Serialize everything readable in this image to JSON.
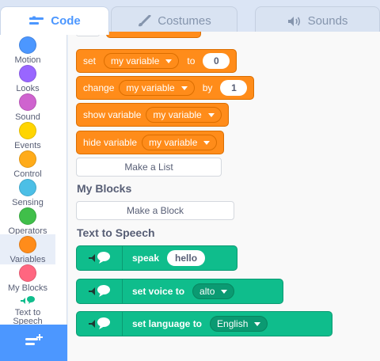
{
  "tabs": [
    {
      "label": "Code",
      "icon": "code-icon"
    },
    {
      "label": "Costumes",
      "icon": "brush-icon"
    },
    {
      "label": "Sounds",
      "icon": "speaker-icon"
    }
  ],
  "categories": [
    {
      "label": "Motion",
      "color": "#4c97ff"
    },
    {
      "label": "Looks",
      "color": "#9966ff"
    },
    {
      "label": "Sound",
      "color": "#cf63cf"
    },
    {
      "label": "Events",
      "color": "#ffd500"
    },
    {
      "label": "Control",
      "color": "#ffab19"
    },
    {
      "label": "Sensing",
      "color": "#4cbfe6"
    },
    {
      "label": "Operators",
      "color": "#40bf4a"
    },
    {
      "label": "Variables",
      "color": "#ff8c1a"
    },
    {
      "label": "My Blocks",
      "color": "#ff6680"
    },
    {
      "label": "Text to Speech",
      "icon": "text-to-speech-icon"
    }
  ],
  "blocks": {
    "set": {
      "label": "set",
      "variable": "my variable",
      "to": "to",
      "value": "0"
    },
    "change": {
      "label": "change",
      "variable": "my variable",
      "by": "by",
      "value": "1"
    },
    "show": {
      "label": "show variable",
      "variable": "my variable"
    },
    "hide": {
      "label": "hide variable",
      "variable": "my variable"
    }
  },
  "make_list_label": "Make a List",
  "my_blocks_heading": "My Blocks",
  "make_block_label": "Make a Block",
  "tts_heading": "Text to Speech",
  "tts_blocks": {
    "speak": {
      "label": "speak",
      "value": "hello"
    },
    "voice": {
      "label": "set voice to",
      "value": "alto"
    },
    "language": {
      "label": "set language to",
      "value": "English"
    }
  },
  "colors": {
    "accent": "#4c97ff",
    "variables": "#ff8c1a",
    "extension": "#0fbd8c"
  }
}
